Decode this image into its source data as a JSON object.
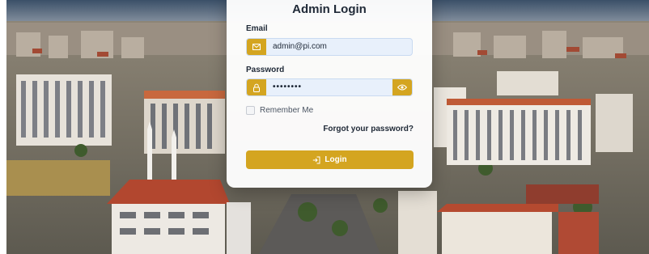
{
  "login": {
    "title": "Admin Login",
    "email_label": "Email",
    "email_value": "admin@pi.com",
    "password_label": "Password",
    "password_value": "••••••••",
    "remember_label": "Remember Me",
    "remember_checked": false,
    "forgot_link": "Forgot your password?",
    "login_button": "Login"
  },
  "icons": {
    "email": "envelope-icon",
    "password": "lock-icon",
    "toggle": "eye-icon",
    "login": "sign-in-icon"
  },
  "colors": {
    "accent": "#d4a520",
    "input_bg": "#e8f0fb",
    "text": "#1f2937"
  }
}
